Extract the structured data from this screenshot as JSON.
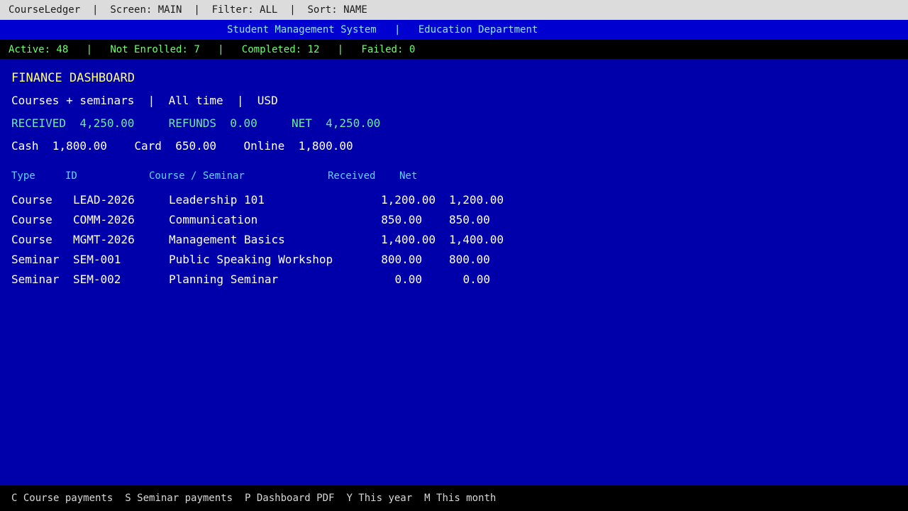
{
  "topbar": {
    "app": "CourseLedger",
    "sep": "|",
    "screen": "Screen: MAIN",
    "filter": "Filter: ALL",
    "sort": "Sort: NAME"
  },
  "sysbar": {
    "system": "Student Management System",
    "sep": "|",
    "department": "Education Department"
  },
  "status": {
    "active": "Active: 48",
    "not_enrolled": "Not Enrolled: 7",
    "completed": "Completed: 12",
    "failed": "Failed: 0",
    "sep": "|"
  },
  "dashboard": {
    "title": "FINANCE DASHBOARD",
    "scope": "Courses + seminars",
    "period": "All time",
    "currency": "USD",
    "sep": "|",
    "received_label": "RECEIVED",
    "received_value": "4,250.00",
    "refunds_label": "REFUNDS",
    "refunds_value": "0.00",
    "net_label": "NET",
    "net_value": "4,250.00",
    "cash_label": "Cash",
    "cash_value": "1,800.00",
    "card_label": "Card",
    "card_value": "650.00",
    "online_label": "Online",
    "online_value": "1,800.00"
  },
  "table": {
    "headers": {
      "type": "Type",
      "id": "ID",
      "name": "Course / Seminar",
      "received": "Received",
      "net": "Net"
    },
    "rows": [
      {
        "type": "Course",
        "id": "LEAD-2026",
        "name": "Leadership 101",
        "received": "1,200.00",
        "net": "1,200.00"
      },
      {
        "type": "Course",
        "id": "COMM-2026",
        "name": "Communication",
        "received": "850.00",
        "net": "850.00"
      },
      {
        "type": "Course",
        "id": "MGMT-2026",
        "name": "Management Basics",
        "received": "1,400.00",
        "net": "1,400.00"
      },
      {
        "type": "Seminar",
        "id": "SEM-001",
        "name": "Public Speaking Workshop",
        "received": "800.00",
        "net": "800.00"
      },
      {
        "type": "Seminar",
        "id": "SEM-002",
        "name": "Planning Seminar",
        "received": "0.00",
        "net": "0.00"
      }
    ]
  },
  "footer": {
    "keys": [
      "C Course payments",
      "S Seminar payments",
      "P Dashboard PDF",
      "Y This year",
      "M This month"
    ]
  },
  "colors": {
    "background": "#0000aa",
    "title": "#ffff7a",
    "totals": "#6fe8a8",
    "header": "#5fd6ff",
    "status_green": "#6dff6d"
  }
}
